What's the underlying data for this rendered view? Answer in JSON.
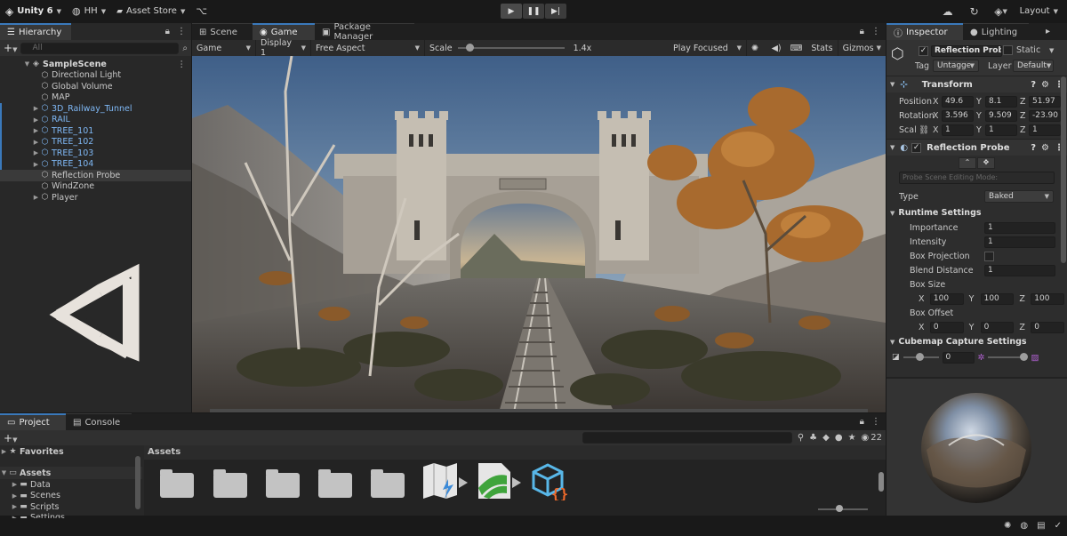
{
  "toolbar": {
    "app": "Unity 6",
    "account": "HH",
    "asset_store": "Asset Store",
    "layout": "Layout"
  },
  "hierarchy": {
    "tab": "Hierarchy",
    "search_placeholder": "All",
    "scene": "SampleScene",
    "items": [
      {
        "label": "Directional Light",
        "prefab": false,
        "arrow": false
      },
      {
        "label": "Global Volume",
        "prefab": false,
        "arrow": false
      },
      {
        "label": "MAP",
        "prefab": false,
        "arrow": false
      },
      {
        "label": "3D_Railway_Tunnel",
        "prefab": true,
        "arrow": true
      },
      {
        "label": "RAIL",
        "prefab": true,
        "arrow": true
      },
      {
        "label": "TREE_101",
        "prefab": true,
        "arrow": true
      },
      {
        "label": "TREE_102",
        "prefab": true,
        "arrow": true
      },
      {
        "label": "TREE_103",
        "prefab": true,
        "arrow": true
      },
      {
        "label": "TREE_104",
        "prefab": true,
        "arrow": true
      },
      {
        "label": "Reflection Probe",
        "prefab": false,
        "arrow": false,
        "selected": true
      },
      {
        "label": "WindZone",
        "prefab": false,
        "arrow": false
      },
      {
        "label": "Player",
        "prefab": false,
        "arrow": true
      }
    ]
  },
  "center_tabs": {
    "scene": "Scene",
    "game": "Game",
    "package_manager": "Package Manager"
  },
  "game_bar": {
    "mode": "Game",
    "display": "Display 1",
    "aspect": "Free Aspect",
    "scale_label": "Scale",
    "scale_value": "1.4x",
    "scale_level": 0.08,
    "play_focused": "Play Focused",
    "stats": "Stats",
    "gizmos": "Gizmos"
  },
  "inspector": {
    "tab": "Inspector",
    "lighting_tab": "Lighting",
    "object_name": "Reflection Probe",
    "static": "Static",
    "tag_label": "Tag",
    "tag": "Untagged",
    "layer_label": "Layer",
    "layer": "Default",
    "transform": {
      "title": "Transform",
      "position_label": "Position",
      "rotation_label": "Rotation",
      "scale_label": "Scal",
      "position": [
        "49.6",
        "8.1",
        "51.97"
      ],
      "rotation": [
        "3.596",
        "9.509",
        "-23.90"
      ],
      "scale": [
        "1",
        "1",
        "1"
      ]
    },
    "probe": {
      "title": "Reflection Probe",
      "editing_mode": "Probe Scene Editing Mode:",
      "type_label": "Type",
      "type": "Baked",
      "runtime_title": "Runtime Settings",
      "importance_label": "Importance",
      "importance": "1",
      "intensity_label": "Intensity",
      "intensity": "1",
      "box_projection_label": "Box Projection",
      "blend_distance_label": "Blend Distance",
      "blend_distance": "1",
      "box_size_label": "Box Size",
      "box_size": [
        "100",
        "100",
        "100"
      ],
      "box_offset_label": "Box Offset",
      "box_offset": [
        "0",
        "0",
        "0"
      ],
      "cubemap_title": "Cubemap Capture Settings",
      "exposure": "0"
    },
    "axis": {
      "x": "X",
      "y": "Y",
      "z": "Z"
    }
  },
  "project": {
    "tab": "Project",
    "console_tab": "Console",
    "favorites": "Favorites",
    "assets": "Assets",
    "tree": [
      "Data",
      "Scenes",
      "Scripts",
      "Settings"
    ],
    "breadcrumb": "Assets",
    "hidden_count": "22"
  }
}
